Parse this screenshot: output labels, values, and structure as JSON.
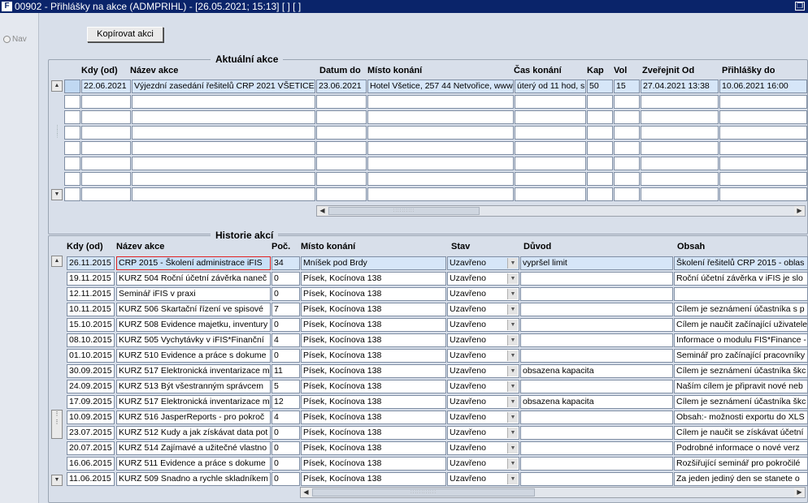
{
  "window": {
    "title": "00902 - Přihlášky na akce (ADMPRIHL) - [26.05.2021; 15:13]  [ ]  [ ]",
    "app_icon": "FIS"
  },
  "nav": {
    "label": "Nav"
  },
  "toolbar": {
    "copy_label": "Kopírovat akci"
  },
  "current": {
    "title": "Aktuální akce",
    "headers": [
      "Kdy (od)",
      "Název akce",
      "Datum do",
      "Místo konání",
      "Čas konání",
      "Kap",
      "Vol",
      "Zveřejnit Od",
      "Přihlášky do"
    ],
    "rows": [
      [
        "22.06.2021",
        "Výjezdní zasedání řešitelů CRP 2021 VŠETICE",
        "23.06.2021",
        "Hotel Všetice, 257 44 Netvořice, www",
        "úterý od 11 hod, s",
        "50",
        "15",
        "27.04.2021 13:38",
        "10.06.2021 16:00"
      ],
      [
        "",
        "",
        "",
        "",
        "",
        "",
        "",
        "",
        ""
      ],
      [
        "",
        "",
        "",
        "",
        "",
        "",
        "",
        "",
        ""
      ],
      [
        "",
        "",
        "",
        "",
        "",
        "",
        "",
        "",
        ""
      ],
      [
        "",
        "",
        "",
        "",
        "",
        "",
        "",
        "",
        ""
      ],
      [
        "",
        "",
        "",
        "",
        "",
        "",
        "",
        "",
        ""
      ],
      [
        "",
        "",
        "",
        "",
        "",
        "",
        "",
        "",
        ""
      ],
      [
        "",
        "",
        "",
        "",
        "",
        "",
        "",
        "",
        ""
      ]
    ]
  },
  "history": {
    "title": "Historie akcí",
    "headers": [
      "Kdy (od)",
      "Název akce",
      "Poč.",
      "Místo konání",
      "Stav",
      "Důvod",
      "Obsah"
    ],
    "rows": [
      [
        "26.11.2015",
        "CRP 2015 - Školení administrace iFIS",
        "34",
        "Mníšek pod Brdy",
        "Uzavřeno",
        "vypršel limit",
        "Školení řešitelů CRP 2015 - oblas"
      ],
      [
        "19.11.2015",
        "KURZ 504 Roční účetní závěrka naneč",
        "0",
        "Písek, Kocínova 138",
        "Uzavřeno",
        "",
        "Roční účetní závěrka v iFIS je slo"
      ],
      [
        "12.11.2015",
        "Seminář iFIS v praxi",
        "0",
        "Písek, Kocínova 138",
        "Uzavřeno",
        "",
        ""
      ],
      [
        "10.11.2015",
        "KURZ 506 Skartační řízení ve spisové",
        "7",
        "Písek, Kocínova 138",
        "Uzavřeno",
        "",
        "Cílem je seznámení účastníka s p"
      ],
      [
        "15.10.2015",
        "KURZ 508 Evidence majetku, inventury",
        "0",
        "Písek, Kocínova 138",
        "Uzavřeno",
        "",
        "Cílem je naučit začínající uživatele"
      ],
      [
        "08.10.2015",
        "KURZ 505 Vychytávky v iFIS*Finanční",
        "4",
        "Písek, Kocínova 138",
        "Uzavřeno",
        "",
        "Informace o modulu FIS*Finance -"
      ],
      [
        "01.10.2015",
        "KURZ 510 Evidence a práce s dokume",
        "0",
        "Písek, Kocínova 138",
        "Uzavřeno",
        "",
        "Seminář pro začínající pracovníky"
      ],
      [
        "30.09.2015",
        "KURZ 517 Elektronická inventarizace m",
        "11",
        "Písek, Kocínova 138",
        "Uzavřeno",
        "obsazena kapacita",
        "Cílem je seznámení účastníka škc"
      ],
      [
        "24.09.2015",
        "KURZ 513 Být všestranným správcem",
        "5",
        "Písek, Kocínova 138",
        "Uzavřeno",
        "",
        "Naším cílem je připravit nové neb"
      ],
      [
        "17.09.2015",
        "KURZ 517 Elektronická inventarizace m",
        "12",
        "Písek, Kocínova 138",
        "Uzavřeno",
        "obsazena kapacita",
        "Cílem je seznámení účastníka škc"
      ],
      [
        "10.09.2015",
        "KURZ 516 JasperReports - pro pokroč",
        "4",
        "Písek, Kocínova 138",
        "Uzavřeno",
        "",
        "Obsah:- možnosti exportu do XLS"
      ],
      [
        "23.07.2015",
        "KURZ 512 Kudy a jak získávat data pot",
        "0",
        "Písek, Kocínova 138",
        "Uzavřeno",
        "",
        "Cílem je naučit se získávat účetní"
      ],
      [
        "20.07.2015",
        "KURZ 514 Zajímavé a užitečné vlastno",
        "0",
        "Písek, Kocínova 138",
        "Uzavřeno",
        "",
        "Podrobné informace o nové verz"
      ],
      [
        "16.06.2015",
        "KURZ 511 Evidence a práce s dokume",
        "0",
        "Písek, Kocínova 138",
        "Uzavřeno",
        "",
        "Rozšiřující seminář pro pokročilé"
      ],
      [
        "11.06.2015",
        "KURZ 509 Snadno a rychle skladníkem",
        "0",
        "Písek, Kocínova 138",
        "Uzavřeno",
        "",
        "Za jeden jediný den se stanete o"
      ]
    ]
  }
}
